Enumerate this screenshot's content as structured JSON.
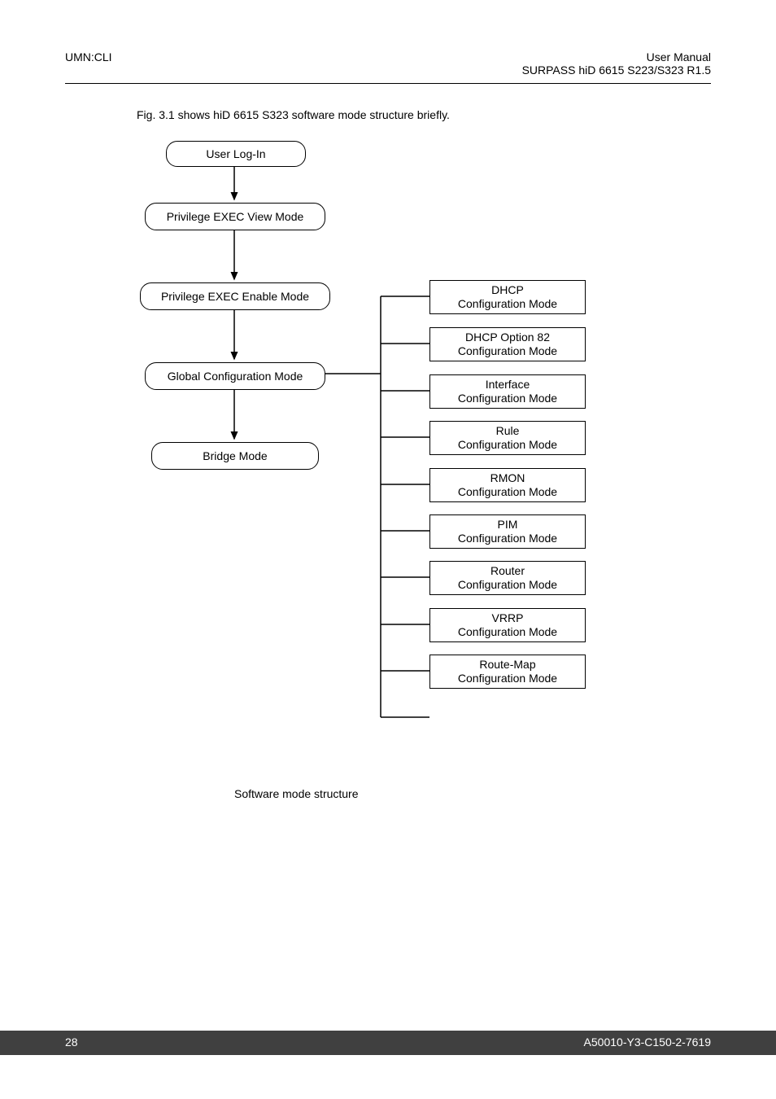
{
  "header": {
    "left": "UMN:CLI",
    "right_line1": "User  Manual",
    "right_line2": "SURPASS hiD 6615 S223/S323 R1.5"
  },
  "intro": "Fig. 3.1 shows hiD 6615 S323 software mode structure briefly.",
  "nodes": {
    "user_login": "User Log-In",
    "priv_view": "Privilege EXEC View Mode",
    "priv_enable": "Privilege EXEC Enable Mode",
    "global_config": "Global Configuration Mode",
    "bridge": "Bridge Mode",
    "dhcp_l1": "DHCP",
    "dhcp_l2": "Configuration Mode",
    "dhcp82_l1": "DHCP Option 82",
    "dhcp82_l2": "Configuration Mode",
    "iface_l1": "Interface",
    "iface_l2": "Configuration Mode",
    "rule_l1": "Rule",
    "rule_l2": "Configuration Mode",
    "rmon_l1": "RMON",
    "rmon_l2": "Configuration Mode",
    "pim_l1": "PIM",
    "pim_l2": "Configuration Mode",
    "router_l1": "Router",
    "router_l2": "Configuration Mode",
    "vrrp_l1": "VRRP",
    "vrrp_l2": "Configuration Mode",
    "routemap_l1": "Route-Map",
    "routemap_l2": "Configuration Mode"
  },
  "caption": "Software mode structure",
  "footer": {
    "page": "28",
    "doc_id": "A50010-Y3-C150-2-7619"
  }
}
